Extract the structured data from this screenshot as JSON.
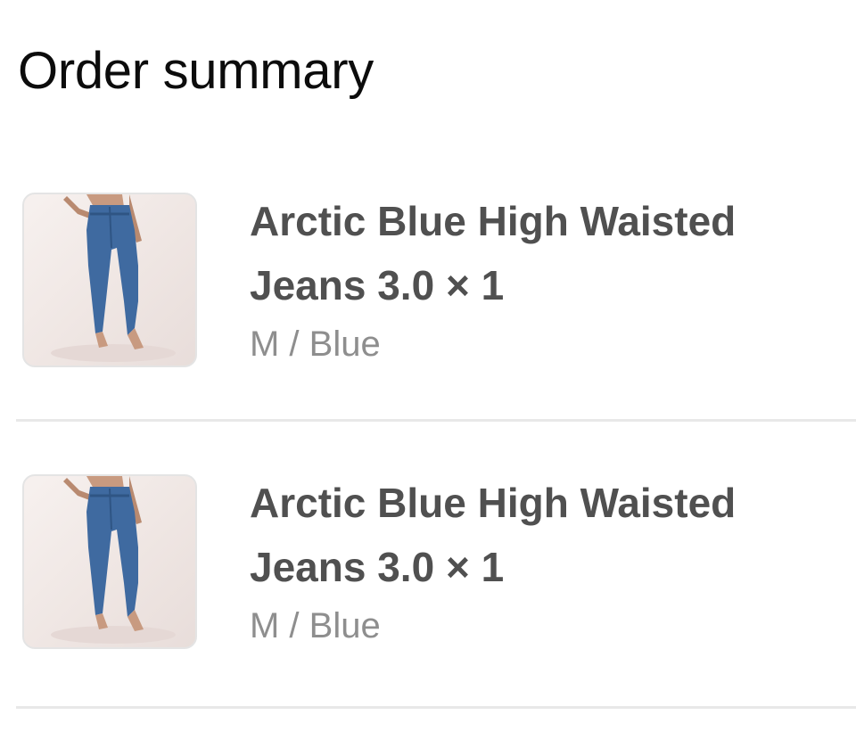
{
  "header": {
    "title": "Order summary"
  },
  "items": [
    {
      "name_line1": "Arctic Blue High Waisted",
      "name_line2": "Jeans 3.0 × 1",
      "variant": "M / Blue"
    },
    {
      "name_line1": "Arctic Blue High Waisted",
      "name_line2": "Jeans 3.0 × 1",
      "variant": "M / Blue"
    }
  ],
  "icons": {
    "product_image": "jeans-product-thumbnail"
  },
  "colors": {
    "title": "#0c0c0c",
    "name": "#505050",
    "variant": "#8e8e8e",
    "divider": "#e8e8e8",
    "denim": "#3f6aa0"
  }
}
